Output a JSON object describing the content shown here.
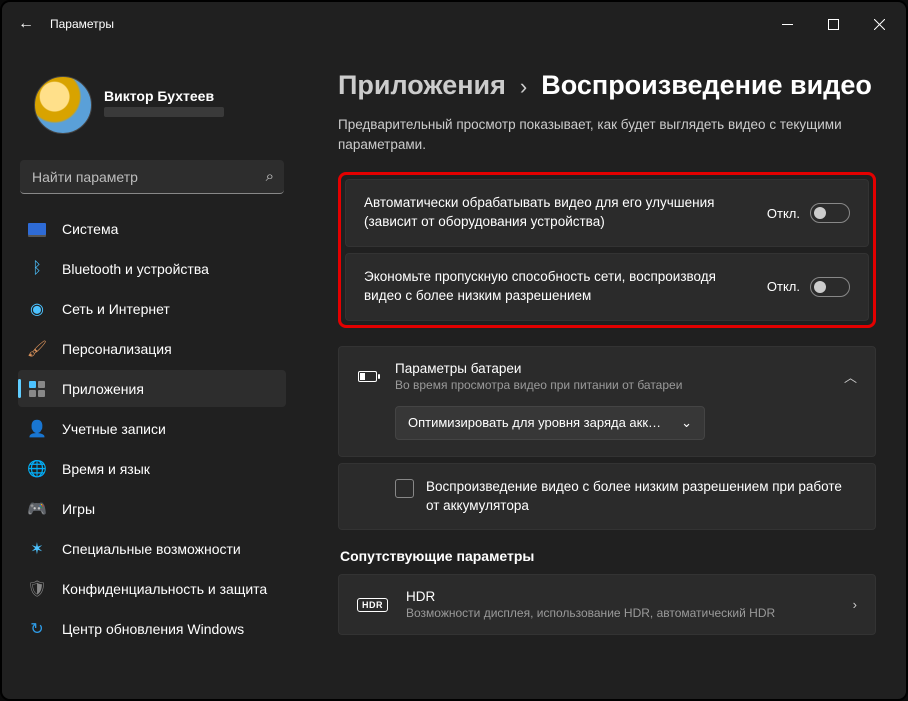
{
  "title": "Параметры",
  "user": {
    "name": "Виктор Бухтеев"
  },
  "search": {
    "placeholder": "Найти параметр"
  },
  "nav": [
    {
      "label": "Система"
    },
    {
      "label": "Bluetooth и устройства"
    },
    {
      "label": "Сеть и Интернет"
    },
    {
      "label": "Персонализация"
    },
    {
      "label": "Приложения"
    },
    {
      "label": "Учетные записи"
    },
    {
      "label": "Время и язык"
    },
    {
      "label": "Игры"
    },
    {
      "label": "Специальные возможности"
    },
    {
      "label": "Конфиденциальность и защита"
    },
    {
      "label": "Центр обновления Windows"
    }
  ],
  "breadcrumb": {
    "parent": "Приложения",
    "sep": "›",
    "current": "Воспроизведение видео"
  },
  "preview_desc": "Предварительный просмотр показывает, как будет выглядеть видео с текущими параметрами.",
  "opt1": {
    "label": "Автоматически обрабатывать видео для его улучшения (зависит от оборудования устройства)",
    "state": "Откл."
  },
  "opt2": {
    "label": "Экономьте пропускную способность сети, воспроизводя видео с более низким разрешением",
    "state": "Откл."
  },
  "battery": {
    "title": "Параметры батареи",
    "sub": "Во время просмотра видео при питании от батареи",
    "select": "Оптимизировать для уровня заряда акк…"
  },
  "lowres_chk": "Воспроизведение видео с более низким разрешением при работе от аккумулятора",
  "related_h": "Сопутствующие параметры",
  "hdr": {
    "badge": "HDR",
    "title": "HDR",
    "sub": "Возможности дисплея, использование HDR, автоматический HDR"
  }
}
